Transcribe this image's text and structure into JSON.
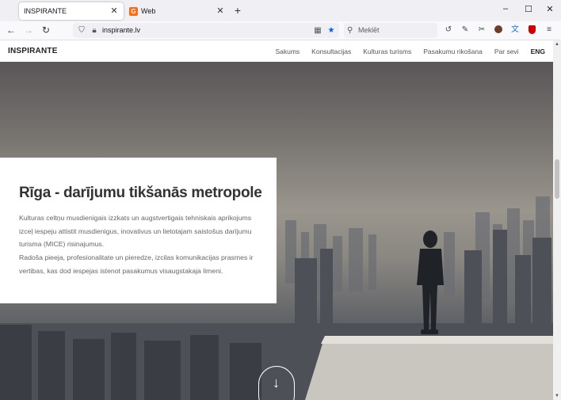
{
  "browser": {
    "tabs": [
      {
        "title": "INSPIRANTE",
        "active": true
      },
      {
        "title": "Web",
        "favicon": "G",
        "active": false
      }
    ],
    "new_tab": "+",
    "window_controls": {
      "minimize": "–",
      "maximize": "☐",
      "close": "✕"
    },
    "url": "inspirante.lv",
    "search_placeholder": "Meklēt",
    "icons": [
      "history-icon",
      "tools-icon",
      "screenshot-icon",
      "profile-icon",
      "translate-icon",
      "ublock-icon",
      "menu-icon"
    ]
  },
  "site": {
    "logo": "INSPIRANTE",
    "nav": [
      "Sakums",
      "Konsultacijas",
      "Kulturas turisms",
      "Pasakumu rikošana",
      "Par sevi",
      "ENG"
    ]
  },
  "hero": {
    "title": "Rīga - darījumu tikšanās metropole",
    "paragraph1": "Kulturas celtņu musdienigais izzkats un augstvertigais tehniskais aprikojums izceļ iespeju attistit musdienigus, inovativus un lietotajam saistošus darījumu turisma (MICE) risinajumus.",
    "paragraph2": "Radoša pieeja, profesionalitate un pieredze, izcilas komunikacijas prasmes ir vertibas, kas dod iespejas istenot pasakumus visaugstakaja limeni.",
    "scroll_arrow": "↓"
  },
  "colors": {
    "tab_bar": "#f0f0f4",
    "bookmark_star": "#0060df",
    "favicon": "#ff6a13",
    "title_text": "#333333",
    "body_text": "#666666"
  }
}
